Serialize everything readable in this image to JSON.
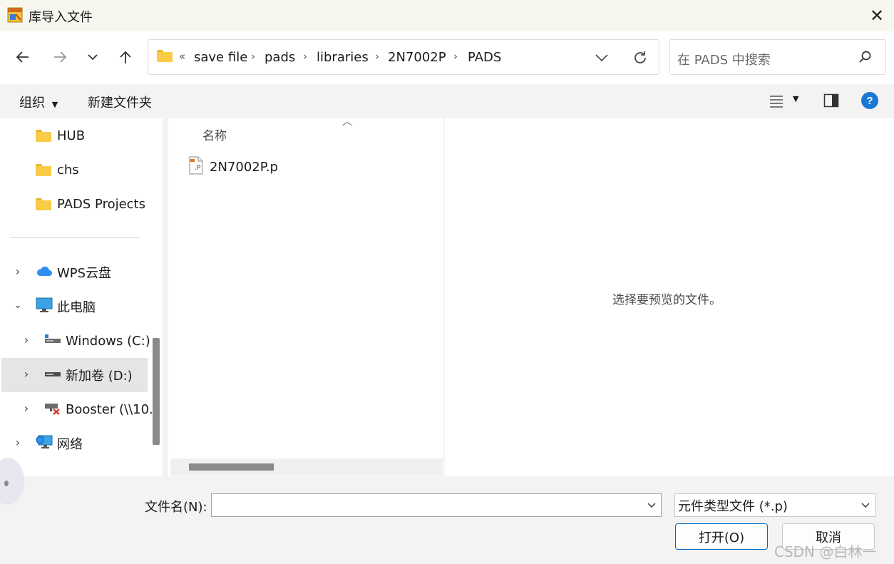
{
  "window": {
    "title": "库导入文件",
    "app_icon": "pads-app-icon",
    "close_glyph": "✕"
  },
  "nav": {
    "back_icon": "arrow-left-icon",
    "forward_icon": "arrow-right-icon",
    "recent_icon": "chevron-down-icon",
    "up_icon": "arrow-up-icon",
    "overflow": "«",
    "breadcrumbs": [
      "save file",
      "pads",
      "libraries",
      "2N7002P",
      "PADS"
    ],
    "separator": "›",
    "search_placeholder": "在 PADS 中搜索"
  },
  "commands": {
    "organize": "组织",
    "new_folder": "新建文件夹"
  },
  "sidebar": {
    "items": [
      {
        "label": "HUB",
        "icon": "folder-icon"
      },
      {
        "label": "chs",
        "icon": "folder-icon"
      },
      {
        "label": "PADS Projects",
        "icon": "folder-icon"
      },
      {
        "label": "WPS云盘",
        "icon": "cloud-icon"
      },
      {
        "label": "此电脑",
        "icon": "computer-icon"
      },
      {
        "label": "Windows (C:)",
        "icon": "drive-icon"
      },
      {
        "label": "新加卷 (D:)",
        "icon": "drive-icon"
      },
      {
        "label": "Booster (\\\\10.",
        "icon": "network-drive-icon"
      },
      {
        "label": "网络",
        "icon": "network-icon"
      }
    ]
  },
  "file_list": {
    "column_name": "名称",
    "files": [
      {
        "name": "2N7002P.p",
        "icon": "file-icon"
      }
    ]
  },
  "preview": {
    "message": "选择要预览的文件。"
  },
  "footer": {
    "filename_label": "文件名(N):",
    "filename_value": "",
    "filetype_value": "元件类型文件 (*.p)",
    "open_label": "打开(O)",
    "cancel_label": "取消",
    "watermark": "CSDN @白林一"
  },
  "colors": {
    "accent": "#0067c0",
    "folder": "#f8cc47",
    "help": "#1a78d4"
  }
}
